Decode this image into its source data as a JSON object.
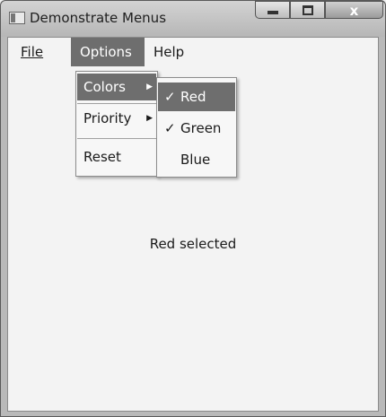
{
  "window": {
    "title": "Demonstrate Menus",
    "caption": {
      "close_glyph": "x"
    }
  },
  "menubar": {
    "file_label": "File",
    "options_label": "Options",
    "help_label": "Help"
  },
  "options_menu": {
    "items": [
      {
        "label": "Colors",
        "has_submenu": true,
        "highlighted": true
      },
      {
        "label": "Priority",
        "has_submenu": true,
        "highlighted": false
      },
      {
        "label": "Reset",
        "has_submenu": false,
        "highlighted": false
      }
    ],
    "arrow_glyph": "▶"
  },
  "colors_submenu": {
    "items": [
      {
        "label": "Red",
        "checked": true,
        "highlighted": true
      },
      {
        "label": "Green",
        "checked": true,
        "highlighted": false
      },
      {
        "label": "Blue",
        "checked": false,
        "highlighted": false
      }
    ],
    "check_glyph": "✓"
  },
  "status_text": "Red selected",
  "colors": {
    "highlight": "#6e6e6e",
    "menu_bg": "#f7f7f7"
  }
}
